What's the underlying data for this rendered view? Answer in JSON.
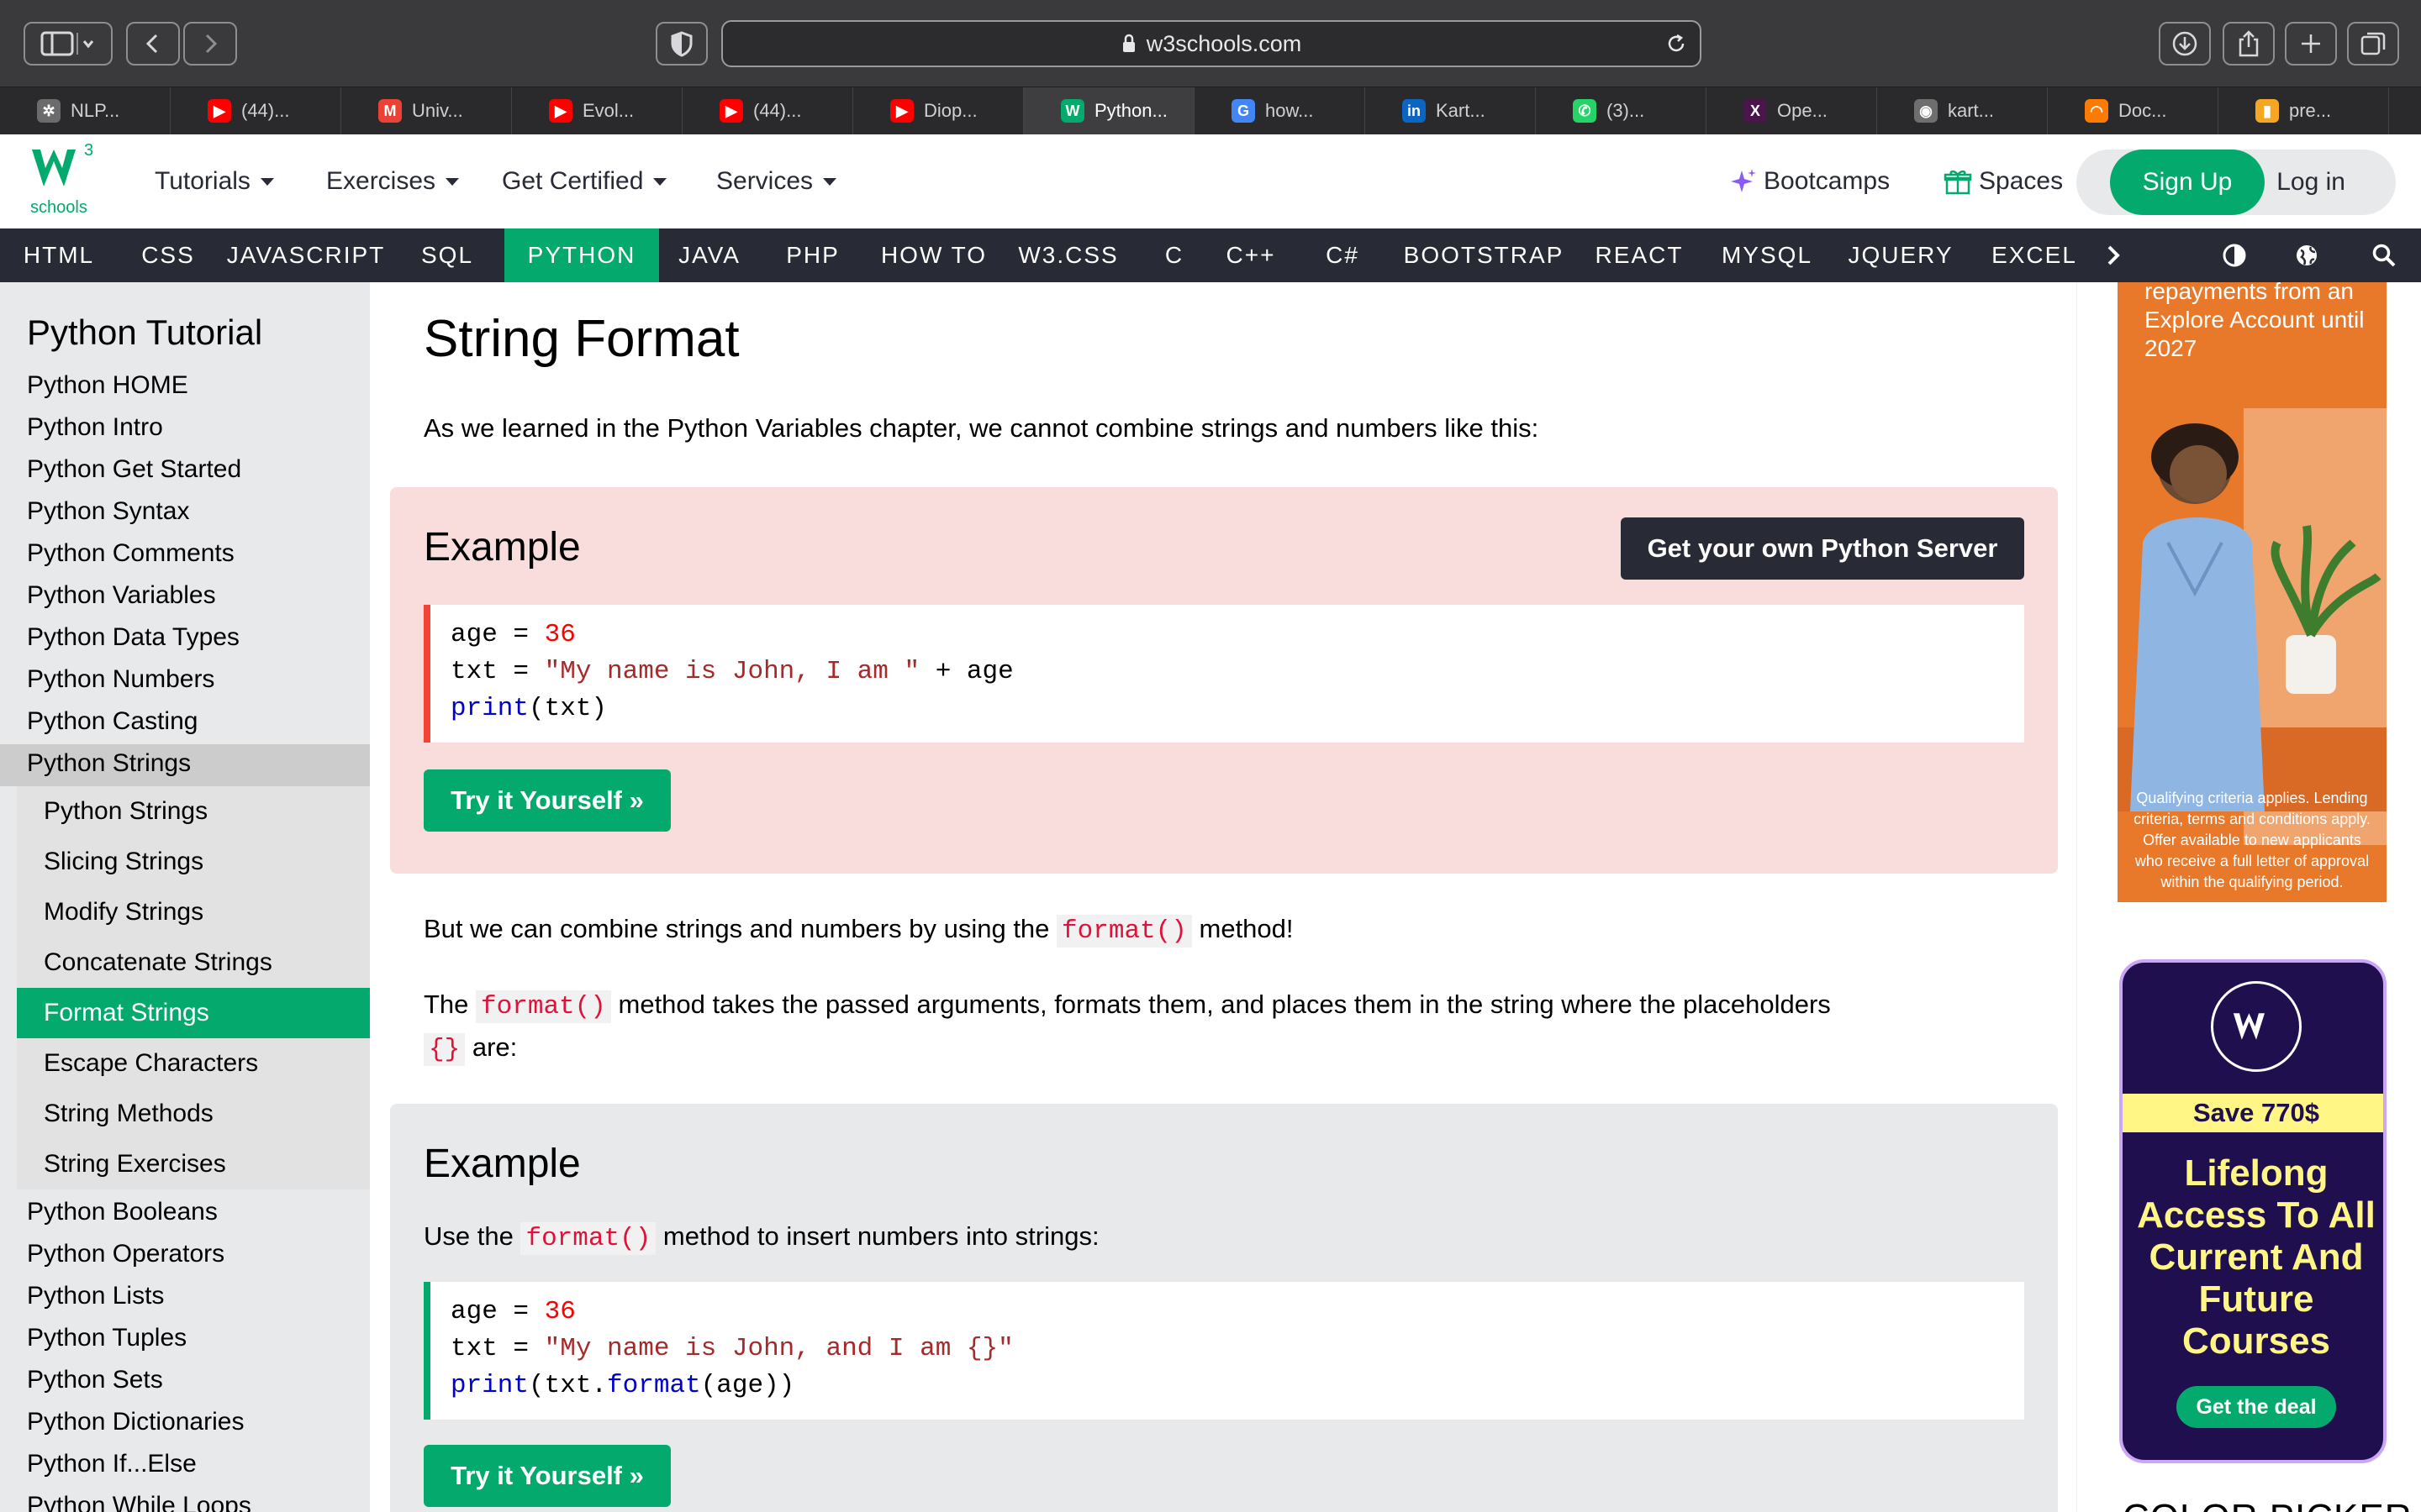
{
  "browser": {
    "url": "w3schools.com",
    "tabs": [
      {
        "label": "NLP...",
        "icon": "openai-icon",
        "color": "#6b6b6b"
      },
      {
        "label": "(44)...",
        "icon": "youtube-icon",
        "color": "#ff0000"
      },
      {
        "label": "Univ...",
        "icon": "gmail-icon",
        "color": "#ea4335"
      },
      {
        "label": "Evol...",
        "icon": "youtube-icon",
        "color": "#ff0000"
      },
      {
        "label": "(44)...",
        "icon": "youtube-icon",
        "color": "#ff0000"
      },
      {
        "label": "Diop...",
        "icon": "youtube-icon",
        "color": "#ff0000"
      },
      {
        "label": "Python...",
        "icon": "w3schools-icon",
        "color": "#04aa6d"
      },
      {
        "label": "how...",
        "icon": "google-icon",
        "color": "#4285f4"
      },
      {
        "label": "Kart...",
        "icon": "linkedin-icon",
        "color": "#0a66c2"
      },
      {
        "label": "(3)...",
        "icon": "whatsapp-icon",
        "color": "#25d366"
      },
      {
        "label": "Ope...",
        "icon": "x-icon",
        "color": "#4a154b"
      },
      {
        "label": "kart...",
        "icon": "github-icon",
        "color": "#6e6e6e"
      },
      {
        "label": "Doc...",
        "icon": "loading-icon",
        "color": "#ff7a00"
      },
      {
        "label": "pre...",
        "icon": "book-icon",
        "color": "#f5a623"
      }
    ]
  },
  "topnav": {
    "logo_sub": "schools",
    "logo_sup": "3",
    "menus": [
      "Tutorials",
      "Exercises",
      "Get Certified",
      "Services"
    ],
    "bootcamps": "Bootcamps",
    "spaces": "Spaces",
    "signup": "Sign Up",
    "login": "Log in"
  },
  "subnav": [
    "HTML",
    "CSS",
    "JAVASCRIPT",
    "SQL",
    "PYTHON",
    "JAVA",
    "PHP",
    "HOW TO",
    "W3.CSS",
    "C",
    "C++",
    "C#",
    "BOOTSTRAP",
    "REACT",
    "MYSQL",
    "JQUERY",
    "EXCEL"
  ],
  "sidebar": {
    "title": "Python Tutorial",
    "links_top": [
      "Python HOME",
      "Python Intro",
      "Python Get Started",
      "Python Syntax",
      "Python Comments",
      "Python Variables",
      "Python Data Types",
      "Python Numbers",
      "Python Casting",
      "Python Strings"
    ],
    "sublinks": [
      "Python Strings",
      "Slicing Strings",
      "Modify Strings",
      "Concatenate Strings",
      "Format Strings",
      "Escape Characters",
      "String Methods",
      "String Exercises"
    ],
    "links_bottom": [
      "Python Booleans",
      "Python Operators",
      "Python Lists",
      "Python Tuples",
      "Python Sets",
      "Python Dictionaries",
      "Python If...Else",
      "Python While Loops"
    ]
  },
  "main": {
    "title": "String Format",
    "intro": "As we learned in the Python Variables chapter, we cannot combine strings and numbers like this:",
    "example1": {
      "title": "Example",
      "server_button": "Get your own Python Server",
      "code": {
        "l1_var": "age",
        "l1_op": " = ",
        "l1_num": "36",
        "l2_var": "txt",
        "l2_op": " = ",
        "l2_str": "\"My name is John, I am \"",
        "l2_rest": " + age",
        "l3_fn": "print",
        "l3_rest": "(txt)"
      },
      "try_button": "Try it Yourself »"
    },
    "para1_pre": "But we can combine strings and numbers by using the",
    "para1_code": "format()",
    "para1_post": "method!",
    "para2_pre": "The",
    "para2_code": "format()",
    "para2_post": "method takes the passed arguments, formats them, and places them in the string where the placeholders",
    "para2_code2": "{}",
    "para2_end": "are:",
    "example2": {
      "title": "Example",
      "desc_pre": "Use the",
      "desc_code": "format()",
      "desc_post": "method to insert numbers into strings:",
      "code": {
        "l1_var": "age",
        "l1_op": " = ",
        "l1_num": "36",
        "l2_var": "txt",
        "l2_op": " = ",
        "l2_str": "\"My name is John, and I am {}\"",
        "l3_fn": "print",
        "l3_a": "(txt.",
        "l3_fn2": "format",
        "l3_b": "(age))"
      },
      "try_button": "Try it Yourself »"
    }
  },
  "ads": {
    "ad1_text": "repayments from an Explore Account until 2027",
    "ad1_fine": "Qualifying criteria applies. Lending criteria, terms and conditions apply. Offer available to new applicants who receive a full letter of approval within the qualifying period.",
    "ad2_save": "Save 770$",
    "ad2_headline": "Lifelong Access To All Current And Future Courses",
    "ad2_button": "Get the deal",
    "next_section": "COLOR PICKER"
  }
}
